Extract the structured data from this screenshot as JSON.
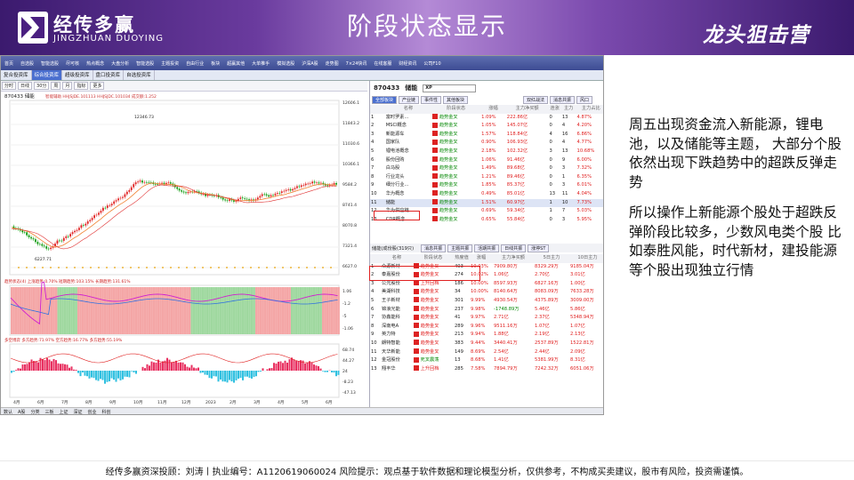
{
  "header": {
    "brand_cn": "经传多赢",
    "brand_en": "JINGZHUAN DUOYING",
    "title": "阶段状态显示",
    "right_brand": "龙头狙击营"
  },
  "menubar": [
    "首页",
    "自选股",
    "智能选股",
    "尽可核",
    "热点概念",
    "大盘分析",
    "智能选股",
    "主题投资",
    "自由行业",
    "板块",
    "超赢其他",
    "大单推手",
    "模拟选股",
    "沪深A股",
    "走势图",
    "7×24快讯",
    "在线客服",
    "财经资讯",
    "公司F10"
  ],
  "tabs": [
    "复合投资库",
    "综合投资库",
    "超级投资库",
    "盘口投资库",
    "自选投资库"
  ],
  "toolbar": [
    "分时",
    "日线",
    "30分",
    "周",
    "月",
    "指标",
    "更多"
  ],
  "chart": {
    "stock_label": "870433 储能",
    "ma_label": "智能辅助 HHJSJDE.101113 HHJSJDC.101034 成交额:1.252",
    "high_label": "12346.73",
    "low_label": "6227.71",
    "price_ticks": [
      "12606.1",
      "11843.2",
      "11030.6",
      "10366.1",
      "9584.2",
      "8741.4",
      "8070.8",
      "7321.4",
      "6627.0"
    ],
    "panel2_title": "趋势状态(4) 上涨趋势:0.70%  短期趋势:103.15%  长期趋势:131.61%",
    "panel2_ticks": [
      "1.06",
      "-1.2",
      "-5",
      "-1.06"
    ],
    "panel3_title": "多空博弈 多方趋势:71.97%  空方趋势:16.77%  多方趋势:55.19%",
    "panel3_ticks": [
      "68.74",
      "44.27",
      "24",
      "-8.23",
      "-47.13"
    ],
    "x_ticks": [
      "4月",
      "6月",
      "7月",
      "8月",
      "9月",
      "10月",
      "11月",
      "12月",
      "2023",
      "2月",
      "3月",
      "4月",
      "5月",
      "6月"
    ]
  },
  "quote": {
    "code": "870433",
    "name": "储能",
    "search": "XP",
    "tabs1": [
      "全部板块",
      "产业链",
      "事件性",
      "其他板块"
    ],
    "tabs2": [
      "双红战法",
      "消息共振",
      "风口"
    ],
    "columns": [
      "",
      "名称",
      "阶段状态",
      "涨幅",
      "主力净买额",
      "净买率",
      "连涨",
      "主力",
      "主力占比"
    ],
    "rows": [
      [
        "1",
        "富时罗素...",
        "趋势金叉",
        "1.09%",
        "222.86亿",
        "0",
        "13",
        "4.87%"
      ],
      [
        "2",
        "MSCI概念",
        "趋势金叉",
        "1.05%",
        "145.07亿",
        "0",
        "4",
        "4.20%"
      ],
      [
        "3",
        "新能源车",
        "趋势金叉",
        "1.57%",
        "118.84亿",
        "4",
        "16",
        "6.86%"
      ],
      [
        "4",
        "国家队",
        "趋势金叉",
        "0.90%",
        "106.93亿",
        "0",
        "4",
        "4.77%"
      ],
      [
        "5",
        "锂电池概念",
        "趋势金叉",
        "2.18%",
        "102.32亿",
        "3",
        "13",
        "10.68%"
      ],
      [
        "6",
        "股份回购",
        "趋势金叉",
        "1.06%",
        "91.46亿",
        "0",
        "9",
        "6.00%"
      ],
      [
        "7",
        "白马股",
        "趋势金叉",
        "1.49%",
        "89.68亿",
        "0",
        "3",
        "7.32%"
      ],
      [
        "8",
        "行业龙头",
        "趋势金叉",
        "1.21%",
        "89.46亿",
        "0",
        "1",
        "6.35%"
      ],
      [
        "9",
        "细分行业...",
        "趋势金叉",
        "1.85%",
        "85.37亿",
        "0",
        "3",
        "6.01%"
      ],
      [
        "10",
        "华为概念",
        "趋势金叉",
        "0.49%",
        "85.01亿",
        "13",
        "11",
        "4.04%"
      ],
      [
        "11",
        "储能",
        "趋势金叉",
        "1.51%",
        "60.97亿",
        "1",
        "10",
        "7.73%"
      ],
      [
        "12",
        "华为供应链",
        "趋势金叉",
        "0.69%",
        "59.34亿",
        "1",
        "7",
        "5.03%"
      ],
      [
        "13",
        "CDR概念",
        "趋势金叉",
        "0.65%",
        "55.84亿",
        "0",
        "3",
        "5.95%"
      ]
    ],
    "sub_title": "储能(成份股(319只)",
    "sub_tabs": [
      "消息共振",
      "主题共振",
      "活期共振",
      "日线共振",
      "涨停ST"
    ],
    "sub_columns": [
      "",
      "名称",
      "阶段状态",
      "热度值",
      "涨幅",
      "主力净买额",
      "5日主力",
      "10日主力"
    ],
    "sub_rows": [
      [
        "1",
        "众源新材",
        "趋势金叉",
        "403",
        "10.03%",
        "7909.80万",
        "8329.29万",
        "9185.04万"
      ],
      [
        "2",
        "泰嘉股份",
        "趋势金叉",
        "274",
        "10.02%",
        "1.06亿",
        "2.70亿",
        "3.01亿"
      ],
      [
        "3",
        "公元股份",
        "上升回档",
        "186",
        "10.00%",
        "8597.93万",
        "6827.16万",
        "1.00亿"
      ],
      [
        "4",
        "美湖科技",
        "趋势金叉",
        "34",
        "10.00%",
        "8140.64万",
        "8083.09万",
        "7633.28万"
      ],
      [
        "5",
        "王子新材",
        "趋势金叉",
        "301",
        "9.99%",
        "4930.54万",
        "4375.89万",
        "3009.00万"
      ],
      [
        "6",
        "锦浪光能",
        "趋势金叉",
        "237",
        "9.98%",
        "-1748.89万",
        "5.46亿",
        "5.86亿"
      ],
      [
        "7",
        "协鑫能科",
        "趋势金叉",
        "41",
        "9.97%",
        "2.71亿",
        "2.37亿",
        "5348.94万"
      ],
      [
        "8",
        "深南电A",
        "趋势金叉",
        "289",
        "9.96%",
        "9511.16万",
        "1.07亿",
        "1.07亿"
      ],
      [
        "9",
        "英力特",
        "趋势金叉",
        "213",
        "9.94%",
        "1.88亿",
        "2.19亿",
        "2.13亿"
      ],
      [
        "10",
        "朗特智能",
        "趋势金叉",
        "383",
        "9.44%",
        "3440.41万",
        "2537.89万",
        "1522.81万"
      ],
      [
        "11",
        "天华新能",
        "趋势金叉",
        "149",
        "8.69%",
        "2.54亿",
        "2.44亿",
        "2.09亿"
      ],
      [
        "12",
        "金冠股份",
        "死叉震荡",
        "13",
        "8.68%",
        "1.41亿",
        "5381.99万",
        "8.31亿"
      ],
      [
        "13",
        "翔丰华",
        "上升回档",
        "285",
        "7.58%",
        "7894.79万",
        "7242.32万",
        "6051.06万"
      ]
    ]
  },
  "statusbar": [
    "数认",
    "A股",
    "分类",
    "三板",
    "上证",
    "深证",
    "创业",
    "科创"
  ],
  "note": {
    "p1": "周五出现资金流入新能源，锂电池，以及储能等主题， 大部分个股依然出现下跌趋势中的超跌反弹走势",
    "p2": "所以操作上新能源个股处于超跌反弹阶段比较多，少数风电类个股 比如泰胜风能，时代新材，建投能源等个股出现独立行情"
  },
  "footer": "经传多赢资深投顾：刘涛丨执业编号：A1120619060024   风险提示：观点基于软件数据和理论模型分析，仅供参考，不构成买卖建议，股市有风险，投资需谨慎。",
  "colors": {
    "header_dark": "#3b1a6e",
    "header_light": "#b48ad6",
    "up": "#e02020",
    "down": "#0a8a0a",
    "highlight": "#e02020"
  }
}
